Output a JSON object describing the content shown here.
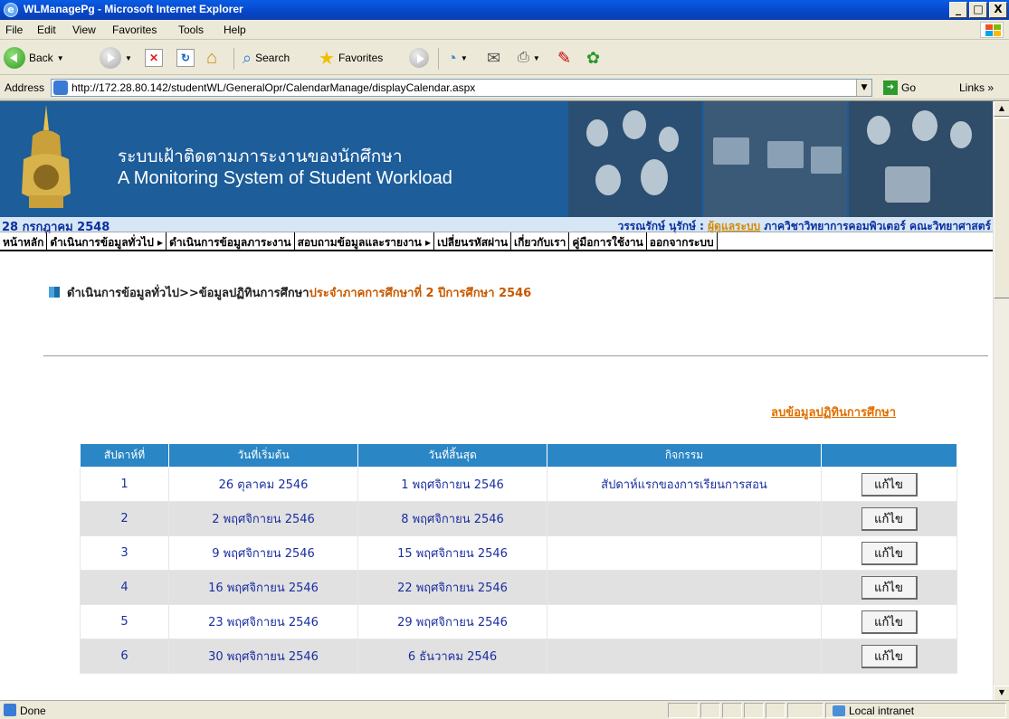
{
  "window": {
    "title": "WLManagePg - Microsoft Internet Explorer",
    "min": "_",
    "max": "□",
    "close": "X"
  },
  "menu": [
    "File",
    "Edit",
    "View",
    "Favorites",
    "Tools",
    "Help"
  ],
  "toolbar": {
    "back": "Back",
    "search": "Search",
    "favorites": "Favorites"
  },
  "address": {
    "label": "Address",
    "url": "http://172.28.80.142/studentWL/GeneralOpr/CalendarManage/displayCalendar.aspx",
    "go": "Go",
    "links": "Links »"
  },
  "banner": {
    "thai_title": "ระบบเฝ้าติดตามภาระงานของนักศึกษา",
    "eng_title": "A Monitoring System of Student Workload"
  },
  "info": {
    "date": "28 กรกฎาคม 2548",
    "user_name": "วรรณรักษ์ นุรักษ์",
    "user_sep": " : ",
    "user_role": "ผู้ดูแลระบบ",
    "user_dept": " ภาควิชาวิทยาการคอมพิวเตอร์ คณะวิทยาศาสตร์"
  },
  "nav": [
    "หน้าหลัก",
    "ดำเนินการข้อมูลทั่วไป ▸",
    "ดำเนินการข้อมูลภาระงาน",
    "สอบถามข้อมูลและรายงาน ▸",
    "เปลี่ยนรหัสผ่าน",
    "เกี่ยวกับเรา",
    "คู่มือการใช้งาน",
    "ออกจากระบบ"
  ],
  "breadcrumb": {
    "path": "ดำเนินการข้อมูลทั่วไป>>ข้อมูลปฏิทินการศึกษา",
    "highlight": "ประจำภาคการศึกษาที่ 2 ปีการศึกษา 2546"
  },
  "delete_link": "ลบข้อมูลปฏิทินการศึกษา",
  "table": {
    "headers": [
      "สัปดาห์ที่",
      "วันที่เริ่มต้น",
      "วันที่สิ้นสุด",
      "กิจกรรม",
      ""
    ],
    "edit_label": "แก้ไข",
    "rows": [
      {
        "week": "1",
        "start": "26 ตุลาคม 2546",
        "end": "1 พฤศจิกายน 2546",
        "activity": "สัปดาห์แรกของการเรียนการสอน"
      },
      {
        "week": "2",
        "start": "2 พฤศจิกายน 2546",
        "end": "8 พฤศจิกายน 2546",
        "activity": ""
      },
      {
        "week": "3",
        "start": "9 พฤศจิกายน 2546",
        "end": "15 พฤศจิกายน 2546",
        "activity": ""
      },
      {
        "week": "4",
        "start": "16 พฤศจิกายน 2546",
        "end": "22 พฤศจิกายน 2546",
        "activity": ""
      },
      {
        "week": "5",
        "start": "23 พฤศจิกายน 2546",
        "end": "29 พฤศจิกายน 2546",
        "activity": ""
      },
      {
        "week": "6",
        "start": "30 พฤศจิกายน 2546",
        "end": "6 ธันวาคม 2546",
        "activity": ""
      }
    ]
  },
  "status": {
    "text": "Done",
    "zone": "Local intranet"
  },
  "colors": {
    "header_bg": "#2a86c4",
    "banner_bg": "#1c5d9a",
    "accent_orange": "#c85a00",
    "link_orange": "#e07000",
    "row_alt": "#e1e1e1"
  }
}
